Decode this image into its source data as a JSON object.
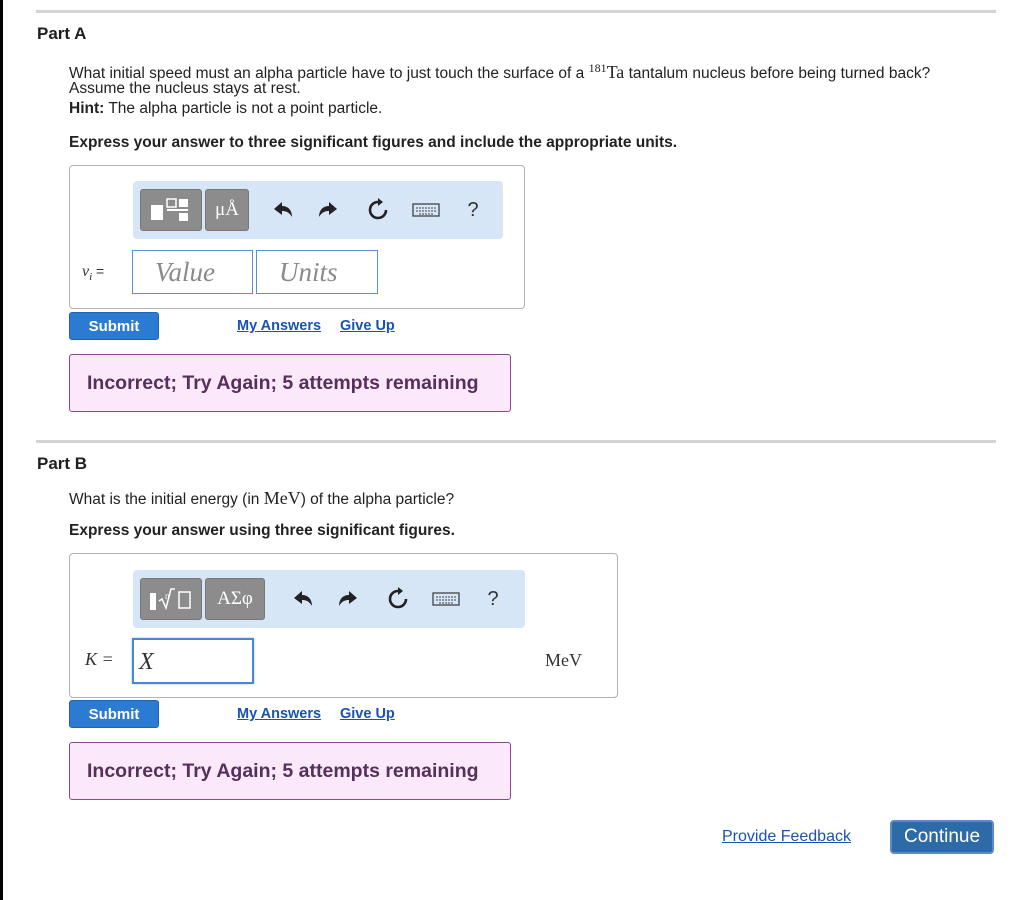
{
  "partA": {
    "title": "Part A",
    "question_pre": "What initial speed must an alpha particle have to just touch the surface of a",
    "isotope_mass": "181",
    "element_symbol": "Ta",
    "question_post": "tantalum nucleus before being turned back?",
    "question_line2": "Assume the nucleus stays at rest.",
    "hint_label": "Hint:",
    "hint_text": "The alpha particle is not a point particle.",
    "instruction": "Express your answer to three significant figures and include the appropriate units.",
    "variable": "vi =",
    "value_placeholder": "Value",
    "units_placeholder": "Units",
    "toolbar_symbol_button": "μÅ",
    "help": "?",
    "submit": "Submit",
    "my_answers": "My Answers",
    "give_up": "Give Up",
    "feedback": "Incorrect; Try Again; 5 attempts remaining"
  },
  "partB": {
    "title": "Part B",
    "question_pre": "What is the initial energy (in",
    "unit_inline": "MeV",
    "question_post": ") of the alpha particle?",
    "instruction": "Express your answer using three significant figures.",
    "variable": "K =",
    "input_value": "X",
    "unit": "MeV",
    "toolbar_symbol_button": "ΑΣφ",
    "help": "?",
    "submit": "Submit",
    "my_answers": "My Answers",
    "give_up": "Give Up",
    "feedback": "Incorrect; Try Again; 5 attempts remaining"
  },
  "footer": {
    "provide_feedback": "Provide Feedback",
    "continue": "Continue"
  },
  "colors": {
    "accent": "#2b7bd3",
    "toolbar_bg": "#d6e6f7",
    "feedback_bg": "#fbe9fb",
    "link": "#1a52b2"
  }
}
